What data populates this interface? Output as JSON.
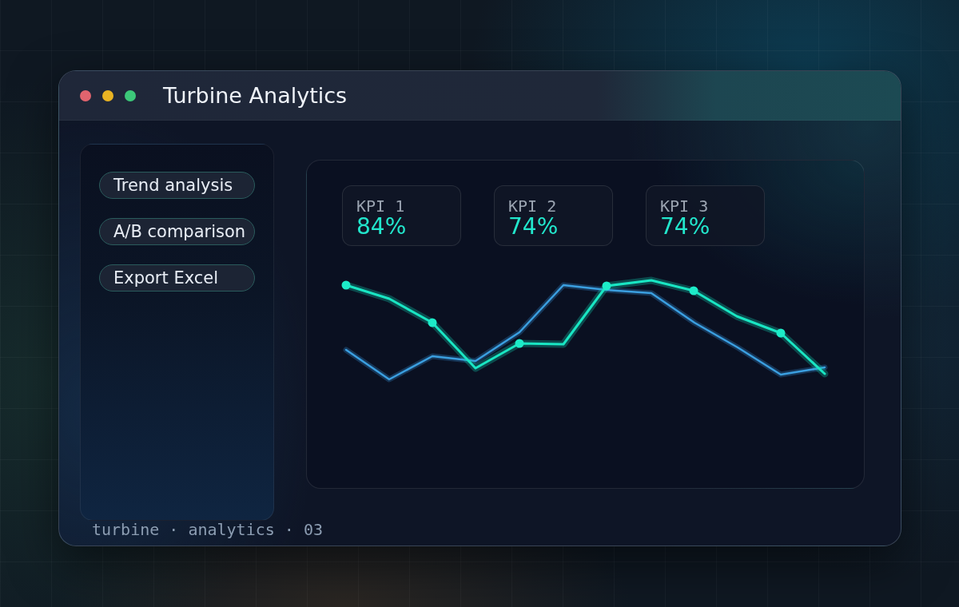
{
  "window": {
    "title": "Turbine Analytics",
    "controls": [
      {
        "color": "#e2646e"
      },
      {
        "color": "#e8b323"
      },
      {
        "color": "#3cc879"
      }
    ]
  },
  "sidebar": {
    "actions": [
      "Trend analysis",
      "A/B comparison",
      "Export Excel"
    ]
  },
  "kpis": [
    {
      "label": "KPI 1",
      "value": "84%"
    },
    {
      "label": "KPI 2",
      "value": "74%"
    },
    {
      "label": "KPI 3",
      "value": "74%"
    }
  ],
  "footer": "turbine · analytics · 03"
}
